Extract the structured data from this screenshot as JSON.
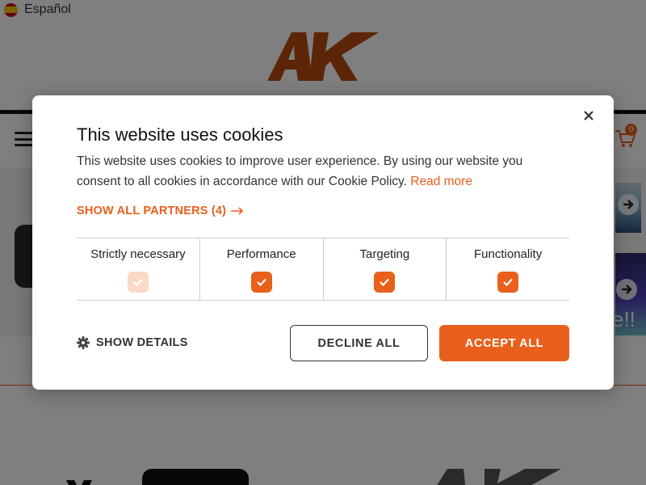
{
  "header": {
    "language_label": "Español",
    "cart_count": "0"
  },
  "banner": {
    "slide_text": "e!!"
  },
  "cookie_dialog": {
    "title": "This website uses cookies",
    "description": "This website uses cookies to improve user experience. By using our website you consent to all cookies in accordance with our Cookie Policy.",
    "read_more_label": "Read more",
    "partners_label": "SHOW ALL PARTNERS (4)",
    "categories": [
      {
        "label": "Strictly necessary",
        "checked": true,
        "disabled": true
      },
      {
        "label": "Performance",
        "checked": true,
        "disabled": false
      },
      {
        "label": "Targeting",
        "checked": true,
        "disabled": false
      },
      {
        "label": "Functionality",
        "checked": true,
        "disabled": false
      }
    ],
    "show_details_label": "SHOW DETAILS",
    "decline_label": "DECLINE ALL",
    "accept_label": "ACCEPT ALL"
  },
  "colors": {
    "accent": "#e8601c",
    "accent_light": "#fbd9c6",
    "overlay": "rgba(0,0,0,0.5)"
  },
  "icons": [
    "spain-flag-icon",
    "ak-logo",
    "hamburger-menu-icon",
    "cart-icon",
    "arrow-right-icon",
    "close-icon",
    "checkmark-icon",
    "gear-icon",
    "long-arrow-right-icon",
    "youtube-logo"
  ]
}
